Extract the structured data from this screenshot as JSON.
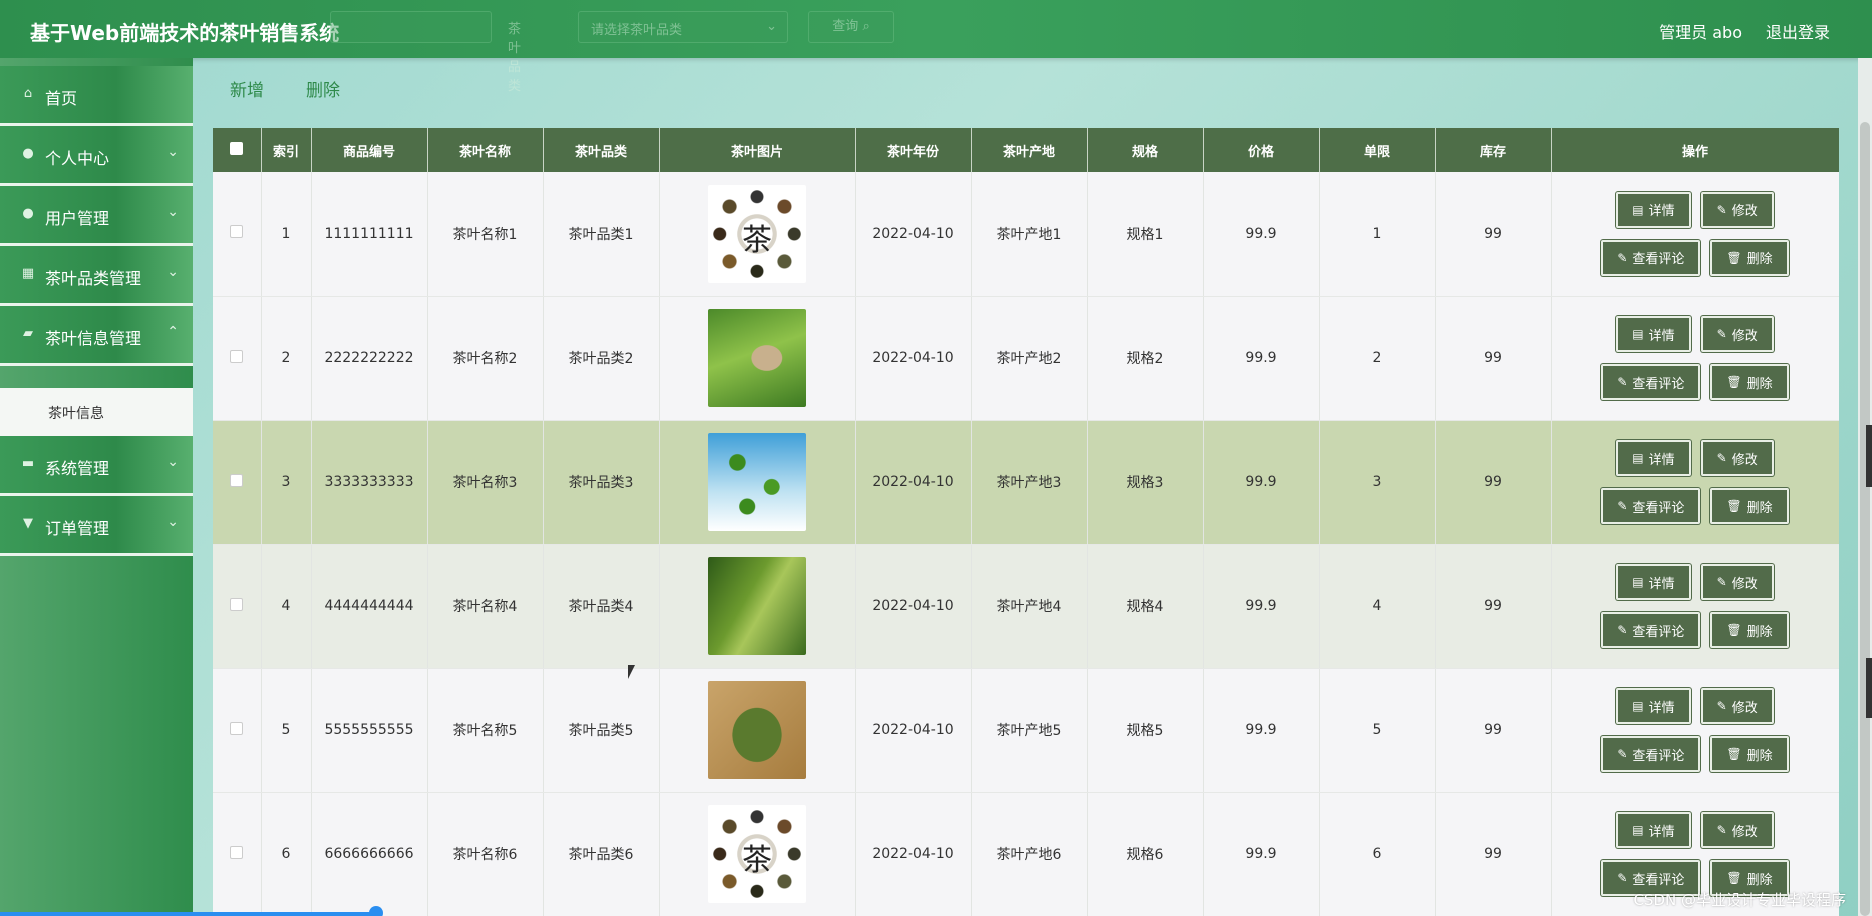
{
  "header": {
    "title": "基于Web前端技术的茶叶销售系统",
    "search_label": "茶叶品类",
    "search_select_placeholder": "请选择茶叶品类",
    "search_button": "查询",
    "user": "管理员 abo",
    "logout": "退出登录"
  },
  "sidebar": {
    "items": [
      {
        "label": "首页",
        "icon": "home-icon"
      },
      {
        "label": "个人中心",
        "icon": "user-icon"
      },
      {
        "label": "用户管理",
        "icon": "pin-icon"
      },
      {
        "label": "茶叶品类管理",
        "icon": "grid-icon"
      },
      {
        "label": "茶叶信息管理",
        "icon": "thumbs-icon"
      },
      {
        "label": "系统管理",
        "icon": "briefcase-icon"
      },
      {
        "label": "订单管理",
        "icon": "trophy-icon"
      }
    ],
    "submenu": {
      "label": "茶叶信息"
    }
  },
  "actions": {
    "add": "新增",
    "delete": "删除"
  },
  "table": {
    "headers": [
      "",
      "索引",
      "商品编号",
      "茶叶名称",
      "茶叶品类",
      "茶叶图片",
      "茶叶年份",
      "茶叶产地",
      "规格",
      "价格",
      "单限",
      "库存",
      "操作"
    ],
    "buttons": {
      "detail": "详情",
      "edit": "修改",
      "comments": "查看评论",
      "delete": "删除"
    },
    "rows": [
      {
        "index": "1",
        "code": "1111111111",
        "name": "茶叶名称1",
        "category": "茶叶品类1",
        "year": "2022-04-10",
        "origin": "茶叶产地1",
        "spec": "规格1",
        "price": "99.9",
        "limit": "1",
        "stock": "99"
      },
      {
        "index": "2",
        "code": "2222222222",
        "name": "茶叶名称2",
        "category": "茶叶品类2",
        "year": "2022-04-10",
        "origin": "茶叶产地2",
        "spec": "规格2",
        "price": "99.9",
        "limit": "2",
        "stock": "99"
      },
      {
        "index": "3",
        "code": "3333333333",
        "name": "茶叶名称3",
        "category": "茶叶品类3",
        "year": "2022-04-10",
        "origin": "茶叶产地3",
        "spec": "规格3",
        "price": "99.9",
        "limit": "3",
        "stock": "99"
      },
      {
        "index": "4",
        "code": "4444444444",
        "name": "茶叶名称4",
        "category": "茶叶品类4",
        "year": "2022-04-10",
        "origin": "茶叶产地4",
        "spec": "规格4",
        "price": "99.9",
        "limit": "4",
        "stock": "99"
      },
      {
        "index": "5",
        "code": "5555555555",
        "name": "茶叶名称5",
        "category": "茶叶品类5",
        "year": "2022-04-10",
        "origin": "茶叶产地5",
        "spec": "规格5",
        "price": "99.9",
        "limit": "5",
        "stock": "99"
      },
      {
        "index": "6",
        "code": "6666666666",
        "name": "茶叶名称6",
        "category": "茶叶品类6",
        "year": "2022-04-10",
        "origin": "茶叶产地6",
        "spec": "规格6",
        "price": "99.9",
        "limit": "6",
        "stock": "99"
      }
    ]
  },
  "watermark": "CSDN @毕业设计专业毕设程序"
}
